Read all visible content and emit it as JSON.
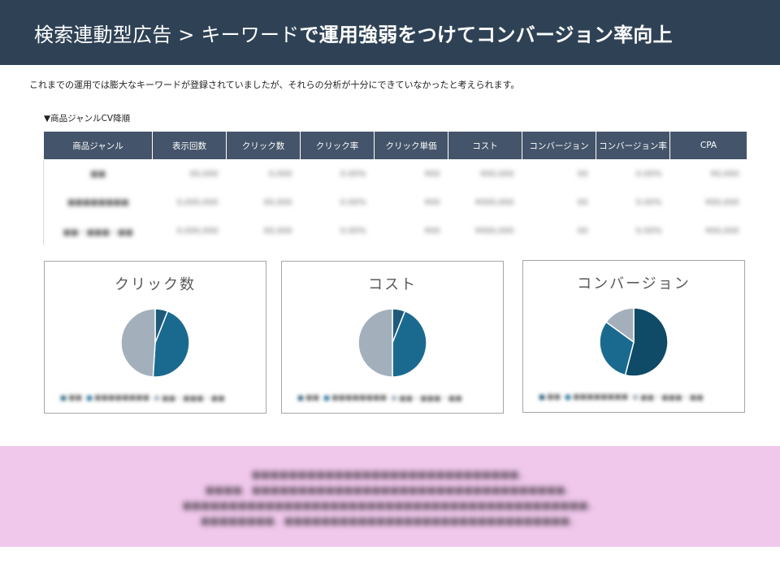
{
  "header": {
    "title_prefix": "検索連動型広告 > キーワード",
    "title_suffix": "で運用強弱をつけてコンバージョン率向上"
  },
  "intro_text": "これまでの運用では膨大なキーワードが登録されていましたが、それらの分析が十分にできていなかったと考えられます。",
  "table": {
    "caption": "▼商品ジャンルCV降順",
    "headers": [
      "商品ジャンル",
      "表示回数",
      "クリック数",
      "クリック率",
      "クリック単価",
      "コスト",
      "コンバージョン",
      "コンバージョン率",
      "CPA"
    ],
    "rows": [
      [
        "■■",
        "00,000",
        "0,000",
        "0.00%",
        "¥00",
        "¥00,000",
        "00",
        "0.00%",
        "¥0,000"
      ],
      [
        "■■■■■■■■",
        "0,000,000",
        "00,000",
        "0.00%",
        "¥00",
        "¥000,000",
        "00",
        "0.00%",
        "¥00,000"
      ],
      [
        "■■・■■■・■■",
        "0,000,000",
        "00,000",
        "0.00%",
        "¥00",
        "¥000,000",
        "00",
        "0.00%",
        "¥00,000"
      ]
    ]
  },
  "charts": [
    {
      "title": "クリック数",
      "legend": [
        "■■",
        "■■■■■■■■",
        "■■・■■■・■■"
      ],
      "chart_data": {
        "type": "pie",
        "categories": [
          "",
          "",
          ""
        ],
        "values": [
          6,
          45,
          49
        ]
      }
    },
    {
      "title": "コスト",
      "legend": [
        "■■",
        "■■■■■■■■",
        "■■・■■■・■■"
      ],
      "chart_data": {
        "type": "pie",
        "categories": [
          "",
          "",
          ""
        ],
        "values": [
          6,
          44,
          50
        ]
      }
    },
    {
      "title": "コンバージョン",
      "legend": [
        "■■",
        "■■■■■■■■",
        "■■・■■■・■■"
      ],
      "chart_data": {
        "type": "pie",
        "categories": [
          "",
          "",
          ""
        ],
        "values": [
          54,
          31,
          15
        ]
      }
    }
  ],
  "pie_colors": [
    "#1f5a7a",
    "#1a6a90",
    "#a3b0bc"
  ],
  "pie_colors_conversion": [
    "#0f4a66",
    "#1a6a90",
    "#a3b0bc"
  ],
  "summary": {
    "lines": [
      "■■■■■■■■■■■■■■■■■■■■■■■■■■■■■。",
      "■■■■、■■■■■■■■■■■■■■■■■■■■■■■■■■■■■■■■■■。",
      "■■■■■■■■■■■■■■■■■■■■■■■■■■■■■■■■■■■■■■■■■■■■。",
      "■■■■■■■■、■■■■■■■■■■■■■■■■■■■■■■■■■■■■■■■。"
    ]
  },
  "colors": {
    "header_bg": "#2f4255",
    "table_header_bg": "#44546a",
    "summary_bg": "#f0c8ec"
  }
}
